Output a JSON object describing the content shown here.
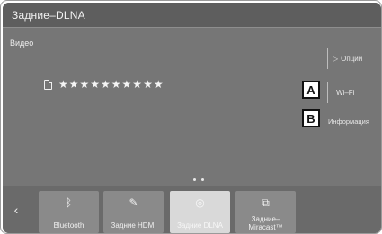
{
  "header": {
    "title": "Задние–DLNA"
  },
  "main": {
    "section_label": "Видео",
    "file_name": "★★★★★★★★★★",
    "buttons": {
      "options_label": "Опции",
      "wifi_label": "Wi–Fi",
      "info_label": "Информация"
    },
    "callouts": {
      "a": "A",
      "b": "B"
    }
  },
  "sources": [
    {
      "label": "Bluetooth",
      "icon": "bluetooth-icon"
    },
    {
      "label": "Задние HDMI",
      "icon": "hdmi-plug-icon"
    },
    {
      "label": "Задние DLNA",
      "icon": "dlna-icon",
      "selected": true
    },
    {
      "label": "Задние–Miracast™",
      "icon": "miracast-icon"
    }
  ],
  "colors": {
    "background": "#767676",
    "title_bar": "#5e5e5e",
    "tile": "#8a8a8a",
    "tile_selected": "#d9d9d9"
  }
}
